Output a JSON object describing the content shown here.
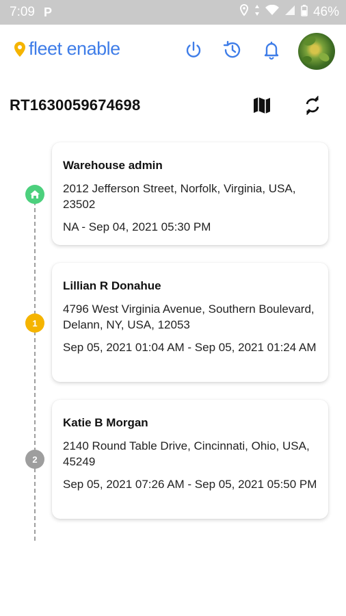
{
  "status_bar": {
    "time": "7:09",
    "battery": "46%"
  },
  "header": {
    "logo_text": "fleet enable",
    "icons": [
      "power-icon",
      "history-icon",
      "bell-icon"
    ]
  },
  "route": {
    "id": "RT1630059674698"
  },
  "stops": [
    {
      "marker": "home",
      "name": "Warehouse admin",
      "address": "2012 Jefferson Street, Norfolk,  Virginia, USA, 23502",
      "time": "NA - Sep 04, 2021  05:30 PM"
    },
    {
      "marker": "1",
      "name": "Lillian R Donahue",
      "address": "4796 West Virginia Avenue,  Southern Boulevard,  Delann,  NY,  USA, 12053",
      "time": "Sep 05, 2021  01:04 AM - Sep 05, 2021 01:24 AM"
    },
    {
      "marker": "2",
      "name": "Katie B Morgan",
      "address": "2140 Round Table Drive,  Cincinnati,  Ohio, USA, 45249",
      "time": "Sep 05, 2021  07:26 AM - Sep 05, 2021 05:50 PM"
    }
  ],
  "colors": {
    "brand_blue": "#3f7de8",
    "logo_pin": "#f5b400",
    "marker_home": "#4cd07d",
    "marker_active": "#f5b400",
    "marker_inactive": "#9e9e9e"
  }
}
